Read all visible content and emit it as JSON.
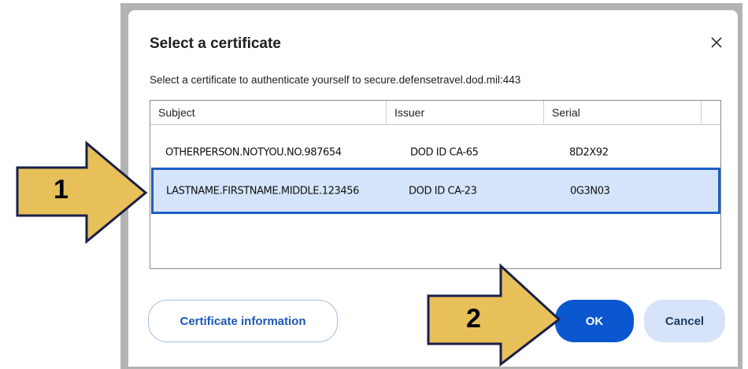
{
  "dialog": {
    "title": "Select a certificate",
    "subtitle": "Select a certificate to authenticate yourself to secure.defensetravel.dod.mil:443",
    "close_icon": "close-icon"
  },
  "table": {
    "columns": [
      "Subject",
      "Issuer",
      "Serial"
    ],
    "rows": [
      {
        "subject": "OTHERPERSON.NOTYOU.NO.987654",
        "issuer": "DOD ID CA-65",
        "serial": "8D2X92",
        "selected": false
      },
      {
        "subject": "LASTNAME.FIRSTNAME.MIDDLE.123456",
        "issuer": "DOD ID CA-23",
        "serial": "0G3N03",
        "selected": true
      }
    ]
  },
  "buttons": {
    "certificate_information": "Certificate information",
    "ok": "OK",
    "cancel": "Cancel"
  },
  "callouts": [
    {
      "label": "1",
      "color": "#e8c05a",
      "outline": "#1a1f4a"
    },
    {
      "label": "2",
      "color": "#e8c05a",
      "outline": "#1a1f4a"
    }
  ],
  "colors": {
    "accent": "#0a57d0",
    "selected_row": "#d6e4fb",
    "selected_border": "#1c5ec4",
    "frame": "#b3b3b3"
  }
}
